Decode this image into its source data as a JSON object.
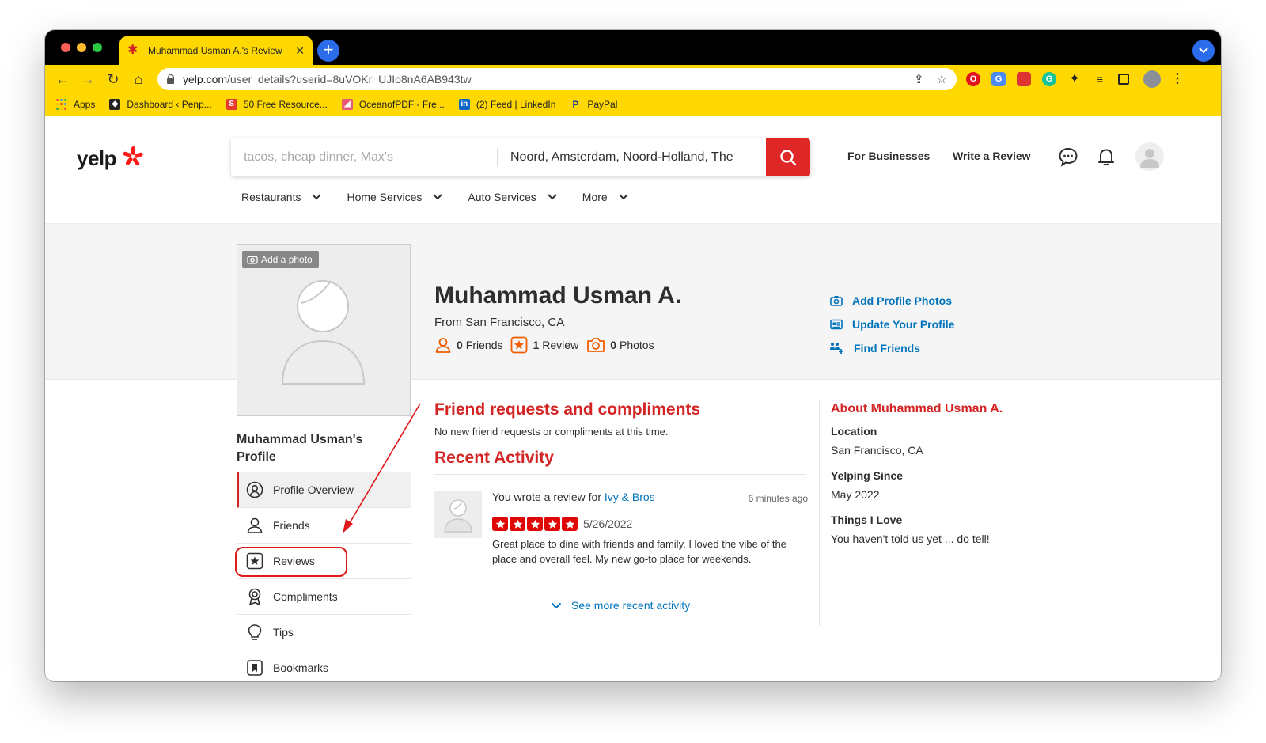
{
  "browser": {
    "tab_title": "Muhammad Usman A.'s Review",
    "url_host": "yelp.com",
    "url_path": "/user_details?userid=8uVOKr_UJIo8nA6AB943tw",
    "bookmarks": [
      {
        "label": "Apps"
      },
      {
        "label": "Dashboard ‹ Penp..."
      },
      {
        "label": "50 Free Resource..."
      },
      {
        "label": "OceanofPDF - Fre..."
      },
      {
        "label": "(2) Feed | LinkedIn"
      },
      {
        "label": "PayPal"
      }
    ]
  },
  "header": {
    "logo": "yelp",
    "search_placeholder": "tacos, cheap dinner, Max's",
    "near_value": "Noord, Amsterdam, Noord-Holland, The",
    "for_businesses": "For Businesses",
    "write_review": "Write a Review"
  },
  "categories": [
    "Restaurants",
    "Home Services",
    "Auto Services",
    "More"
  ],
  "profile": {
    "add_photo": "Add a photo",
    "name": "Muhammad Usman A.",
    "from": "From San Francisco, CA",
    "friends_count": "0",
    "friends_label": "Friends",
    "reviews_count": "1",
    "reviews_label": "Review",
    "photos_count": "0",
    "photos_label": "Photos",
    "actions": [
      "Add Profile Photos",
      "Update Your Profile",
      "Find Friends"
    ]
  },
  "sidebar": {
    "title": "Muhammad Usman's Profile",
    "items": [
      "Profile Overview",
      "Friends",
      "Reviews",
      "Compliments",
      "Tips",
      "Bookmarks"
    ]
  },
  "main": {
    "friend_requests_title": "Friend requests and compliments",
    "friend_requests_text": "No new friend requests or compliments at this time.",
    "recent_activity_title": "Recent Activity",
    "activity": {
      "prefix": "You wrote a review for ",
      "business": "Ivy & Bros",
      "time": "6 minutes ago",
      "rating": 5,
      "date": "5/26/2022",
      "body": "Great place to dine with friends and family. I loved the vibe of the place and overall feel. My new go-to place for weekends."
    },
    "see_more": "See more recent activity"
  },
  "about": {
    "title": "About Muhammad Usman A.",
    "location_label": "Location",
    "location": "San Francisco, CA",
    "since_label": "Yelping Since",
    "since": "May 2022",
    "things_label": "Things I Love",
    "things": "You haven't told us yet ... do tell!"
  },
  "colors": {
    "brand_red": "#d32323",
    "link_blue": "#0073bb",
    "browser_yellow": "#fed800"
  }
}
